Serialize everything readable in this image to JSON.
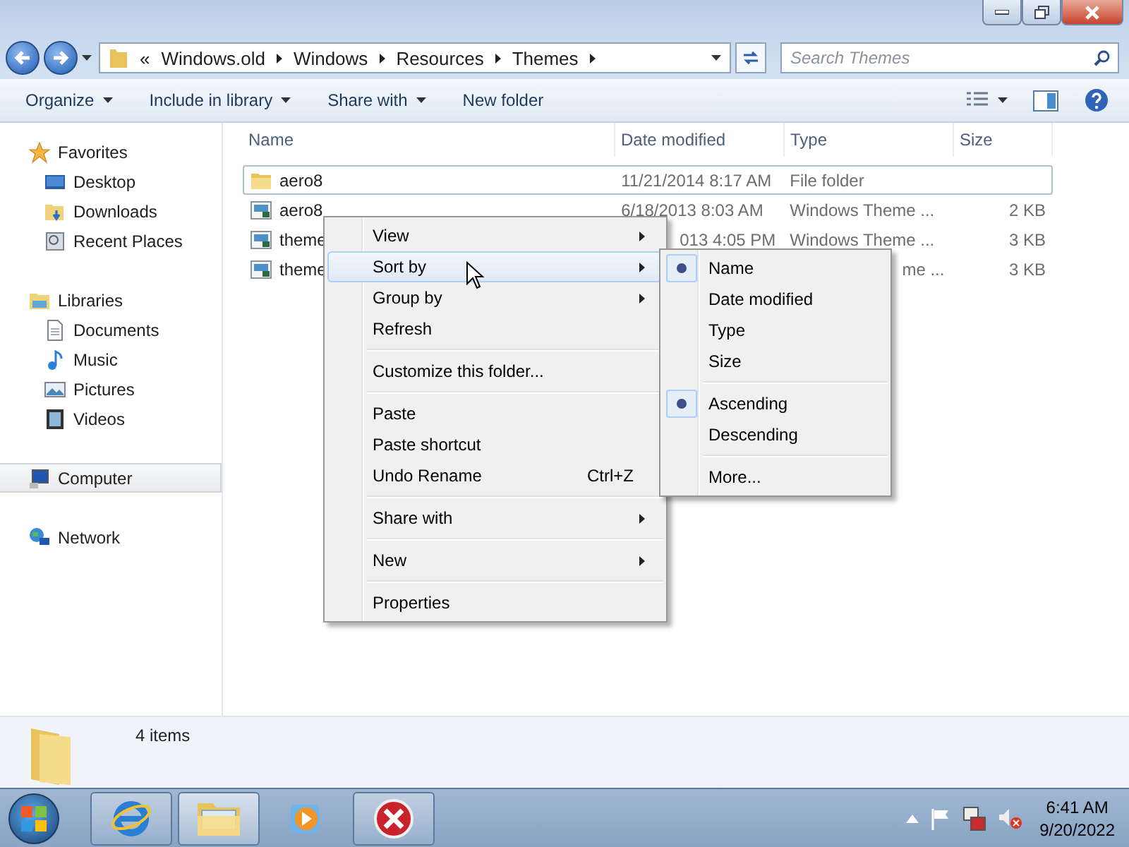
{
  "address_bar": {
    "overflow": "«",
    "segments": [
      "Windows.old",
      "Windows",
      "Resources",
      "Themes"
    ]
  },
  "search": {
    "placeholder": "Search Themes"
  },
  "toolbar": {
    "buttons": [
      {
        "label": "Organize",
        "dropdown": true
      },
      {
        "label": "Include in library",
        "dropdown": true
      },
      {
        "label": "Share with",
        "dropdown": true
      },
      {
        "label": "New folder",
        "dropdown": false
      }
    ]
  },
  "navigation": [
    {
      "label": "Favorites",
      "kind": "favorites",
      "selected": false,
      "children": [
        {
          "label": "Desktop",
          "kind": "desktop",
          "selected": false
        },
        {
          "label": "Downloads",
          "kind": "downloads",
          "selected": false
        },
        {
          "label": "Recent Places",
          "kind": "recent",
          "selected": false
        }
      ]
    },
    {
      "label": "Libraries",
      "kind": "libraries",
      "selected": false,
      "children": [
        {
          "label": "Documents",
          "kind": "documents",
          "selected": false
        },
        {
          "label": "Music",
          "kind": "music",
          "selected": false
        },
        {
          "label": "Pictures",
          "kind": "pictures",
          "selected": false
        },
        {
          "label": "Videos",
          "kind": "videos",
          "selected": false
        }
      ]
    },
    {
      "label": "Computer",
      "kind": "computer",
      "selected": true
    },
    {
      "label": "Network",
      "kind": "network",
      "selected": false
    }
  ],
  "table": {
    "columns": [
      "Name",
      "Date modified",
      "Type",
      "Size"
    ],
    "rows": [
      {
        "kind": "folder",
        "selected": true,
        "name": "aero8",
        "date": "11/21/2014 8:17 AM",
        "type": "File folder"
      },
      {
        "kind": "theme_file",
        "selected": false,
        "name": "aero8",
        "date": "6/18/2013 8:03 AM",
        "type": "Windows Theme ...",
        "size": "2 KB"
      },
      {
        "kind": "theme_file",
        "selected": false,
        "name": "theme",
        "date": "013 4:05 PM",
        "date_cut_start": true,
        "type": "Windows Theme ...",
        "size": "3 KB"
      },
      {
        "kind": "theme_file",
        "selected": false,
        "name": "theme",
        "type": "me ...",
        "type_cut_start": true,
        "size": "3 KB"
      }
    ]
  },
  "context_menu": {
    "items": [
      {
        "kind": "item",
        "label": "View",
        "submenu": true,
        "highlighted": false
      },
      {
        "kind": "item",
        "label": "Sort by",
        "submenu": true,
        "highlighted": true
      },
      {
        "kind": "item",
        "label": "Group by",
        "submenu": true,
        "highlighted": false
      },
      {
        "kind": "item",
        "label": "Refresh",
        "submenu": false,
        "highlighted": false
      },
      {
        "kind": "separator"
      },
      {
        "kind": "item",
        "label": "Customize this folder...",
        "submenu": false,
        "highlighted": false
      },
      {
        "kind": "separator"
      },
      {
        "kind": "item",
        "label": "Paste",
        "submenu": false,
        "highlighted": false
      },
      {
        "kind": "item",
        "label": "Paste shortcut",
        "submenu": false,
        "highlighted": false
      },
      {
        "kind": "item",
        "label": "Undo Rename",
        "shortcut": "Ctrl+Z",
        "submenu": false,
        "highlighted": false
      },
      {
        "kind": "separator"
      },
      {
        "kind": "item",
        "label": "Share with",
        "submenu": true,
        "highlighted": false
      },
      {
        "kind": "separator"
      },
      {
        "kind": "item",
        "label": "New",
        "submenu": true,
        "highlighted": false
      },
      {
        "kind": "separator"
      },
      {
        "kind": "item",
        "label": "Properties",
        "submenu": false,
        "highlighted": false
      }
    ]
  },
  "sort_submenu": {
    "items": [
      {
        "kind": "item",
        "label": "Name",
        "checked": true
      },
      {
        "kind": "item",
        "label": "Date modified",
        "checked": false
      },
      {
        "kind": "item",
        "label": "Type",
        "checked": false
      },
      {
        "kind": "item",
        "label": "Size",
        "checked": false
      },
      {
        "kind": "separator"
      },
      {
        "kind": "item",
        "label": "Ascending",
        "checked": true
      },
      {
        "kind": "item",
        "label": "Descending",
        "checked": false
      },
      {
        "kind": "separator"
      },
      {
        "kind": "item",
        "label": "More...",
        "checked": false
      }
    ]
  },
  "details_pane": {
    "count": "4 items"
  },
  "taskbar": {
    "buttons": [
      {
        "kind": "browser",
        "active": false
      },
      {
        "kind": "explorer",
        "active": true
      },
      {
        "kind": "media",
        "active": false
      },
      {
        "kind": "error",
        "active": false
      }
    ],
    "clock": {
      "time": "6:41 AM",
      "date": "9/20/2022"
    }
  }
}
